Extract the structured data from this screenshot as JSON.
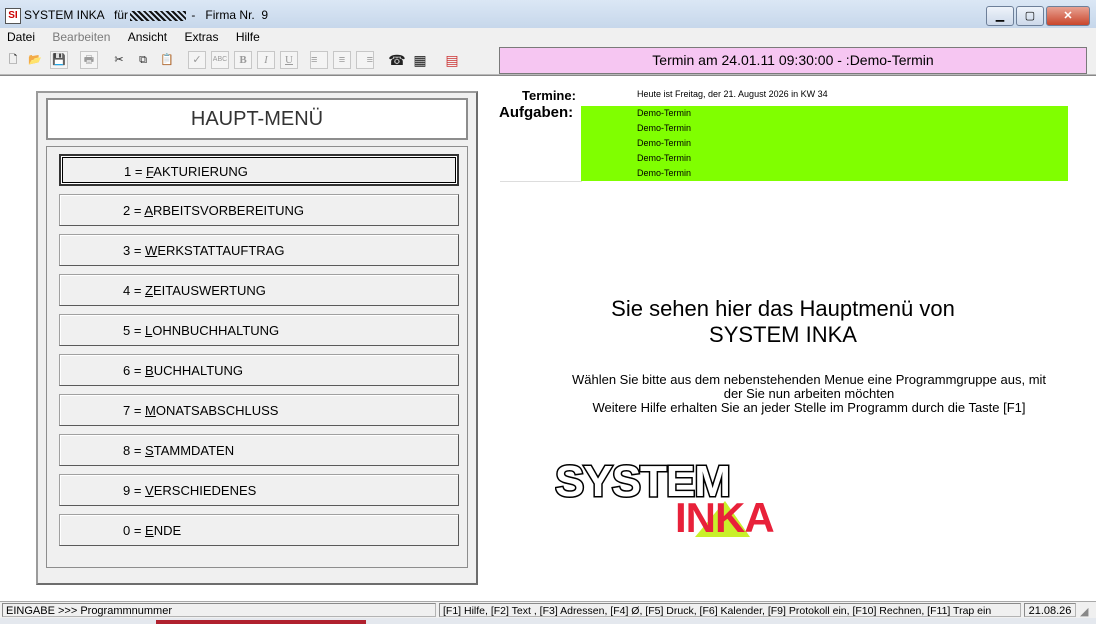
{
  "window": {
    "app_title": "SYSTEM INKA",
    "title_for": "für",
    "title_separator": "-",
    "firma": "Firma Nr.  9",
    "icon_letters": "SI"
  },
  "menubar": [
    "Datei",
    "Bearbeiten",
    "Ansicht",
    "Extras",
    "Hilfe"
  ],
  "toolbar": {
    "termin_banner": "Termin am 24.01.11 09:30:00 - :Demo-Termin",
    "buttons": [
      {
        "name": "new-document",
        "glyph": "🗋",
        "enabled": true
      },
      {
        "name": "open-folder",
        "glyph": "📂",
        "enabled": true
      },
      {
        "name": "save",
        "glyph": "💾",
        "enabled": false
      },
      {
        "name": "print",
        "glyph": "🖶",
        "enabled": false
      },
      {
        "name": "cut",
        "glyph": "✂",
        "enabled": true
      },
      {
        "name": "copy",
        "glyph": "⧉",
        "enabled": true
      },
      {
        "name": "paste",
        "glyph": "📋",
        "enabled": true
      },
      {
        "name": "check",
        "glyph": "✓",
        "enabled": false
      },
      {
        "name": "spellcheck",
        "glyph": "ABC",
        "enabled": false
      },
      {
        "name": "bold",
        "glyph": "B",
        "enabled": false
      },
      {
        "name": "italic",
        "glyph": "I",
        "enabled": false
      },
      {
        "name": "underline",
        "glyph": "U",
        "enabled": false
      },
      {
        "name": "align-left",
        "glyph": "≡",
        "enabled": false
      },
      {
        "name": "align-center",
        "glyph": "≡",
        "enabled": false
      },
      {
        "name": "align-right",
        "glyph": "≡",
        "enabled": false
      },
      {
        "name": "phone",
        "glyph": "☎",
        "enabled": true
      },
      {
        "name": "calculator",
        "glyph": "▦",
        "enabled": true
      },
      {
        "name": "pdf",
        "glyph": "▤",
        "enabled": true
      }
    ]
  },
  "hauptmenu": {
    "title": "HAUPT-MENÜ",
    "items": [
      {
        "pre": "1 = ",
        "hot": "F",
        "rest": "AKTURIERUNG"
      },
      {
        "pre": "2 = ",
        "hot": "A",
        "rest": "RBEITSVORBEREITUNG"
      },
      {
        "pre": "3 = ",
        "hot": "W",
        "rest": "ERKSTATTAUFTRAG"
      },
      {
        "pre": "4 = ",
        "hot": "Z",
        "rest": "EITAUSWERTUNG"
      },
      {
        "pre": "5 = ",
        "hot": "L",
        "rest": "OHNBUCHHALTUNG"
      },
      {
        "pre": "6 = ",
        "hot": "B",
        "rest": "UCHHALTUNG"
      },
      {
        "pre": "7 = ",
        "hot": "M",
        "rest": "ONATSABSCHLUSS"
      },
      {
        "pre": "8 = ",
        "hot": "S",
        "rest": "TAMMDATEN"
      },
      {
        "pre": "9 = ",
        "hot": "V",
        "rest": "ERSCHIEDENES"
      },
      {
        "pre": "0 = ",
        "hot": "E",
        "rest": "NDE"
      }
    ]
  },
  "agenda": {
    "termine_label": "Termine:",
    "aufgaben_label": "Aufgaben:",
    "today": "Heute ist Freitag, der 21. August 2026 in KW 34",
    "entries": [
      "Demo-Termin",
      "Demo-Termin",
      "Demo-Termin",
      "Demo-Termin",
      "Demo-Termin"
    ],
    "highlight_color": "#80ff00"
  },
  "info": {
    "line1": "Sie sehen hier das Hauptmenü von",
    "line2": "SYSTEM INKA",
    "help1": "Wählen Sie bitte aus dem nebenstehenden Menue eine Programmgruppe aus, mit",
    "help2": "der Sie nun arbeiten möchten",
    "help3": "Weitere Hilfe erhalten Sie an jeder Stelle im Programm durch die Taste [F1]"
  },
  "logo": {
    "word1": "SYSTEM",
    "word2": "INKA",
    "red": "#e8213a",
    "green": "#c9f02a"
  },
  "status": {
    "mode": "EINGABE",
    "arrow": ">>>",
    "field": "Programmnummer",
    "keys": "[F1] Hilfe, [F2] Text , [F3] Adressen, [F4] Ø,  [F5] Druck, [F6] Kalender, [F9] Protokoll ein, [F10] Rechnen, [F11] Trap ein",
    "date": "21.08.26"
  }
}
